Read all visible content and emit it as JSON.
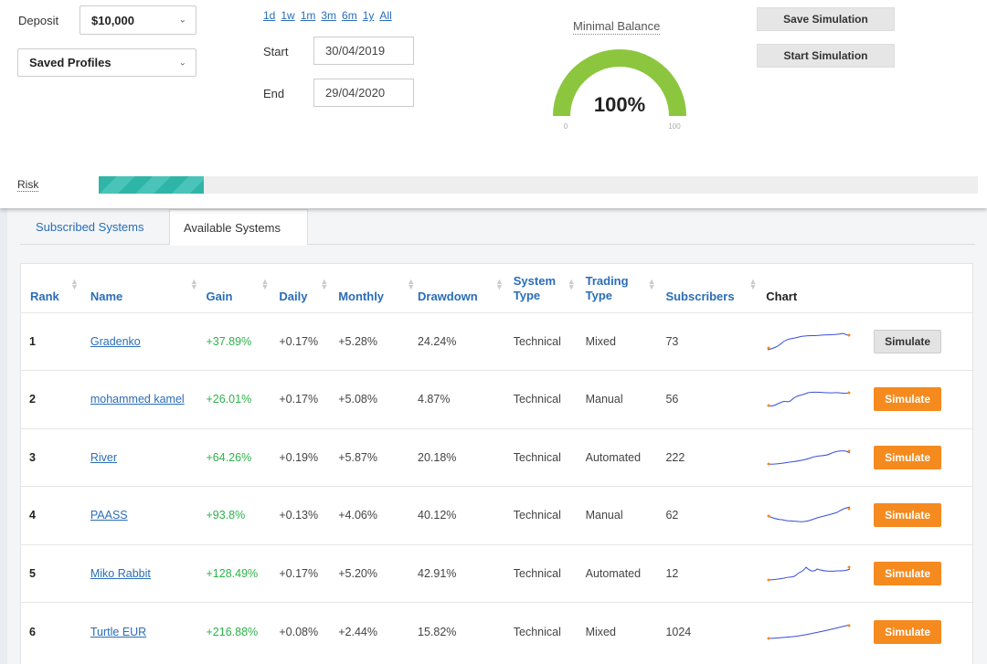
{
  "settings": {
    "deposit_label": "Deposit",
    "deposit_value": "$10,000",
    "profiles_value": "Saved Profiles",
    "ranges": [
      "1d",
      "1w",
      "1m",
      "3m",
      "6m",
      "1y",
      "All"
    ],
    "start_label": "Start",
    "start_value": "30/04/2019",
    "end_label": "End",
    "end_value": "29/04/2020",
    "gauge_title": "Minimal Balance",
    "gauge_value": "100%",
    "gauge_level": 1.0,
    "gauge_min": "0",
    "gauge_max": "100",
    "save_label": "Save Simulation",
    "start_sim_label": "Start Simulation",
    "risk_label": "Risk",
    "risk_level": 0.12
  },
  "colors": {
    "accent": "#2a6db8",
    "gain": "#2db24a",
    "simulate": "#f58a1f",
    "gauge": "#8cc63e",
    "risk": "#2fb5a8"
  },
  "tabs": [
    {
      "label": "Subscribed Systems",
      "active": false
    },
    {
      "label": "Available Systems",
      "active": true
    }
  ],
  "table": {
    "headers": [
      "Rank",
      "Name",
      "Gain",
      "Daily",
      "Monthly",
      "Drawdown",
      "System Type",
      "Trading Type",
      "Subscribers",
      "Chart"
    ],
    "rows": [
      {
        "rank": "1",
        "name": "Gradenko",
        "gain": "+37.89%",
        "daily": "+0.17%",
        "monthly": "+5.28%",
        "drawdown": "24.24%",
        "system": "Technical",
        "trading": "Mixed",
        "subs": "73",
        "button": "Simulate",
        "enabled": false
      },
      {
        "rank": "2",
        "name": "mohammed kamel",
        "gain": "+26.01%",
        "daily": "+0.17%",
        "monthly": "+5.08%",
        "drawdown": "4.87%",
        "system": "Technical",
        "trading": "Manual",
        "subs": "56",
        "button": "Simulate",
        "enabled": true
      },
      {
        "rank": "3",
        "name": "River",
        "gain": "+64.26%",
        "daily": "+0.19%",
        "monthly": "+5.87%",
        "drawdown": "20.18%",
        "system": "Technical",
        "trading": "Automated",
        "subs": "222",
        "button": "Simulate",
        "enabled": true
      },
      {
        "rank": "4",
        "name": "PAASS",
        "gain": "+93.8%",
        "daily": "+0.13%",
        "monthly": "+4.06%",
        "drawdown": "40.12%",
        "system": "Technical",
        "trading": "Manual",
        "subs": "62",
        "button": "Simulate",
        "enabled": true
      },
      {
        "rank": "5",
        "name": "Miko Rabbit",
        "gain": "+128.49%",
        "daily": "+0.17%",
        "monthly": "+5.20%",
        "drawdown": "42.91%",
        "system": "Technical",
        "trading": "Automated",
        "subs": "12",
        "button": "Simulate",
        "enabled": true
      },
      {
        "rank": "6",
        "name": "Turtle EUR",
        "gain": "+216.88%",
        "daily": "+0.08%",
        "monthly": "+2.44%",
        "drawdown": "15.82%",
        "system": "Technical",
        "trading": "Mixed",
        "subs": "1024",
        "button": "Simulate",
        "enabled": true
      }
    ]
  }
}
